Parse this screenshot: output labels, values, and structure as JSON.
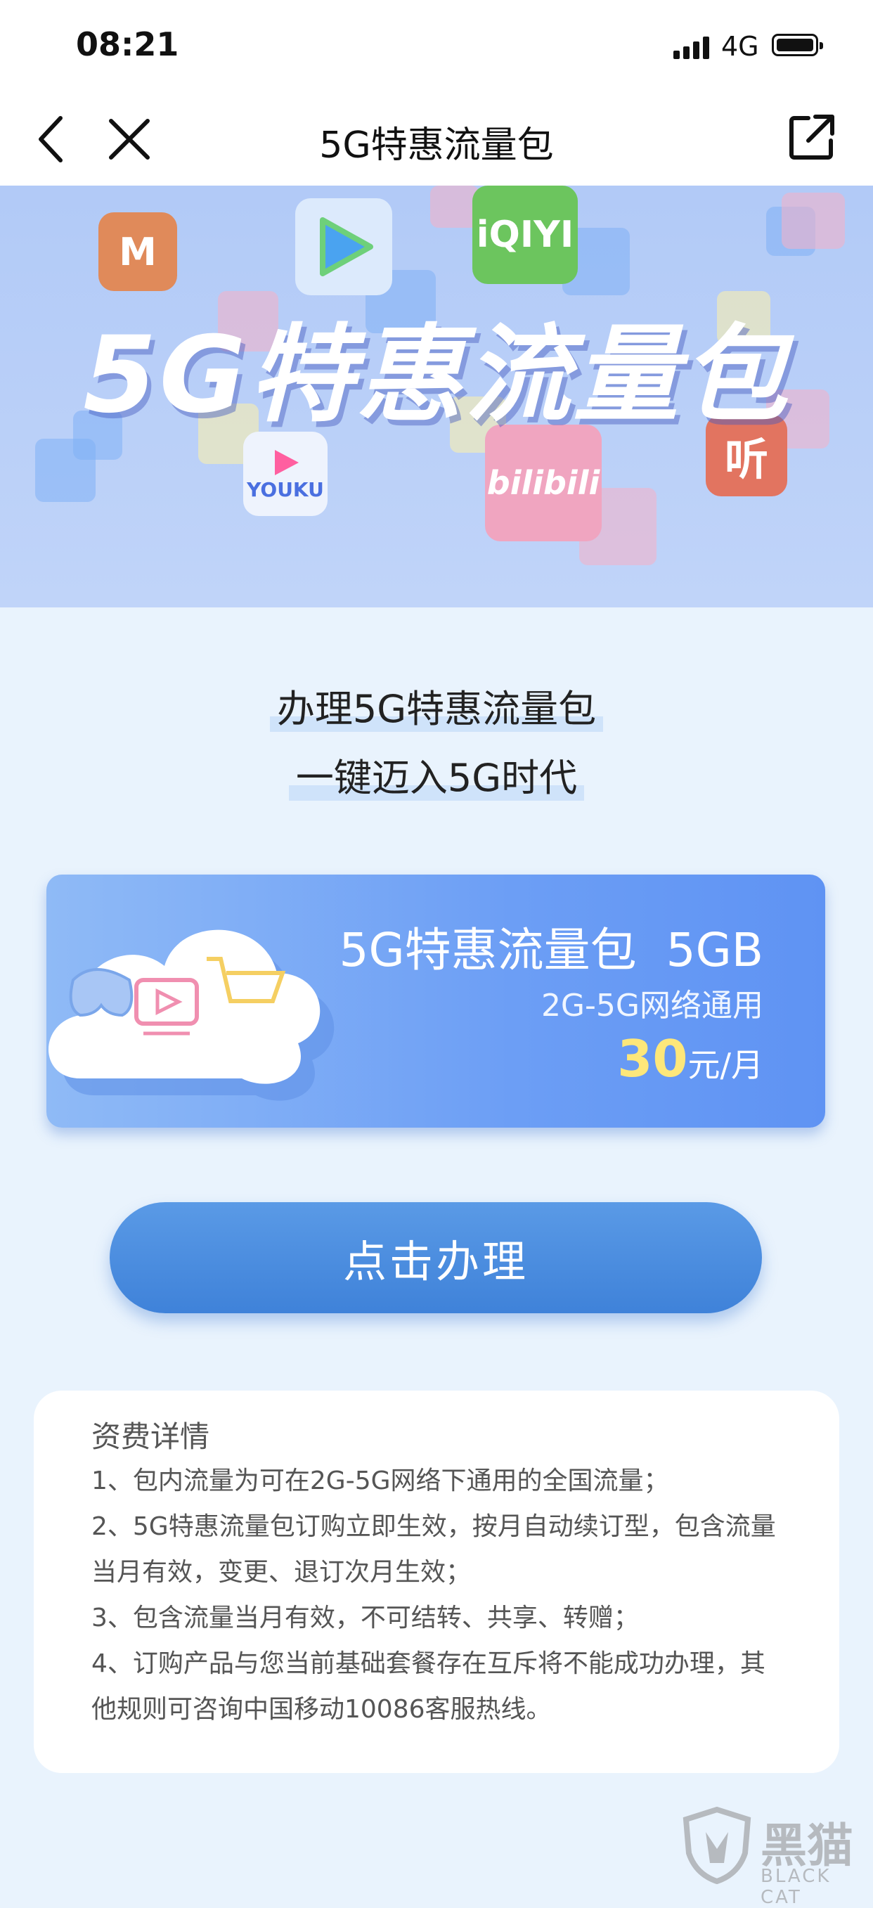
{
  "status_bar": {
    "time": "08:21",
    "network": "4G"
  },
  "nav": {
    "title": "5G特惠流量包"
  },
  "banner": {
    "title": "5G特惠流量包",
    "apps": [
      "MGTV",
      "Tencent Video",
      "iQIYI",
      "YOUKU",
      "bilibili",
      "听"
    ]
  },
  "slogan": {
    "line1": "办理5G特惠流量包",
    "line2": "一键迈入5G时代"
  },
  "package": {
    "name": "5G特惠流量包  5GB",
    "network": "2G-5G网络通用",
    "price": "30",
    "price_unit": "元/月"
  },
  "cta": {
    "label": "点击办理"
  },
  "terms": {
    "title": "资费详情",
    "lines": [
      "1、包内流量为可在2G-5G网络下通用的全国流量；",
      "2、5G特惠流量包订购立即生效，按月自动续订型，包含流量",
      "当月有效，变更、退订次月生效；",
      "3、包含流量当月有效，不可结转、共享、转赠；",
      "4、订购产品与您当前基础套餐存在互斥将不能成功办理，其",
      "他规则可咨询中国移动10086客服热线。"
    ]
  },
  "watermark": {
    "text": "黑猫",
    "sub": "BLACK CAT"
  },
  "colors": {
    "accent": "#4a8ce0",
    "price": "#fde77a",
    "card": "#6c9ef5"
  }
}
